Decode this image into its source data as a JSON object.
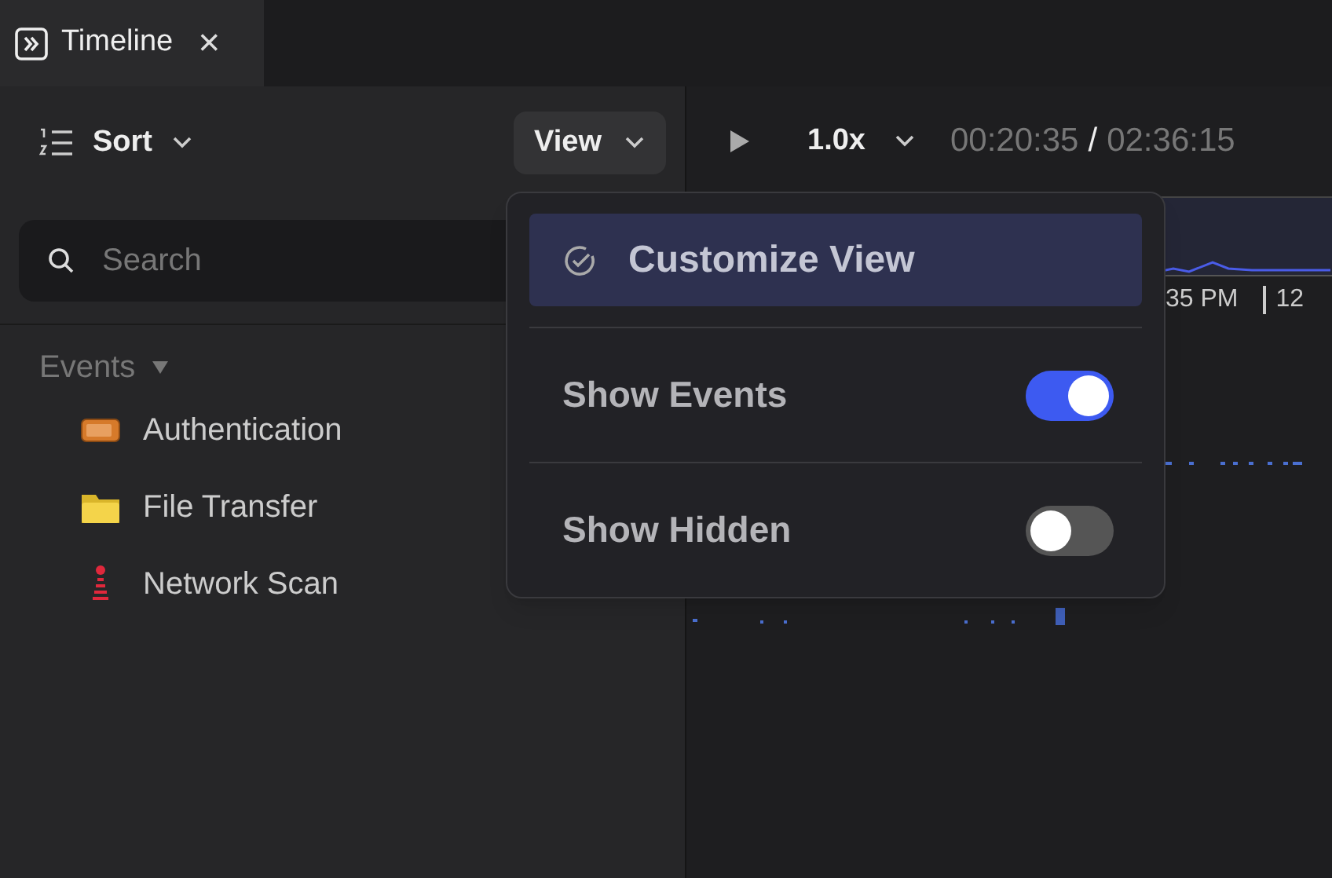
{
  "tab": {
    "title": "Timeline",
    "close": "×"
  },
  "toolbar": {
    "sort": "Sort",
    "view": "View"
  },
  "search": {
    "placeholder": "Search"
  },
  "events": {
    "heading": "Events",
    "expanded": true,
    "items": [
      {
        "label": "Authentication",
        "kind": "vpn"
      },
      {
        "label": "File Transfer",
        "kind": "folder"
      },
      {
        "label": "Network Scan",
        "kind": "scan"
      }
    ]
  },
  "player": {
    "speed": "1.0x",
    "current": "00:20:35",
    "separator": "/",
    "total": "02:36:15"
  },
  "timeline": {
    "labels": [
      "35 PM",
      "12"
    ]
  },
  "menu": {
    "title": "Customize View",
    "options": [
      {
        "label": "Show Events",
        "on": true
      },
      {
        "label": "Show Hidden",
        "on": false
      }
    ]
  }
}
